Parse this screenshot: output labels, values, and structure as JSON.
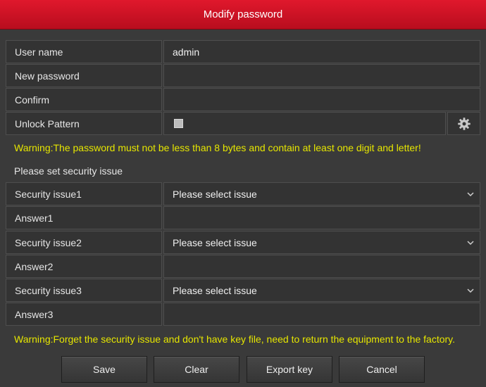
{
  "dialog": {
    "title": "Modify password"
  },
  "form": {
    "username": {
      "label": "User name",
      "value": "admin"
    },
    "new_password": {
      "label": "New password",
      "value": ""
    },
    "confirm": {
      "label": "Confirm",
      "value": ""
    },
    "unlock_pattern": {
      "label": "Unlock Pattern",
      "checked": false,
      "icon": "gear-icon"
    }
  },
  "warning_password": "Warning:The password must not be less than 8 bytes and contain at least one digit and letter!",
  "security": {
    "heading": "Please set security issue",
    "items": [
      {
        "issue_label": "Security issue1",
        "issue_value": "Please select issue",
        "answer_label": "Answer1",
        "answer_value": ""
      },
      {
        "issue_label": "Security issue2",
        "issue_value": "Please select issue",
        "answer_label": "Answer2",
        "answer_value": ""
      },
      {
        "issue_label": "Security issue3",
        "issue_value": "Please select issue",
        "answer_label": "Answer3",
        "answer_value": ""
      }
    ]
  },
  "warning_factory": "Warning:Forget the security issue and don't have key file, need to return the equipment to the factory.",
  "buttons": {
    "save": "Save",
    "clear": "Clear",
    "export_key": "Export key",
    "cancel": "Cancel"
  },
  "colors": {
    "title_bar": "#c8102e",
    "background": "#3a3a3a",
    "warning_text": "#e6e600"
  }
}
